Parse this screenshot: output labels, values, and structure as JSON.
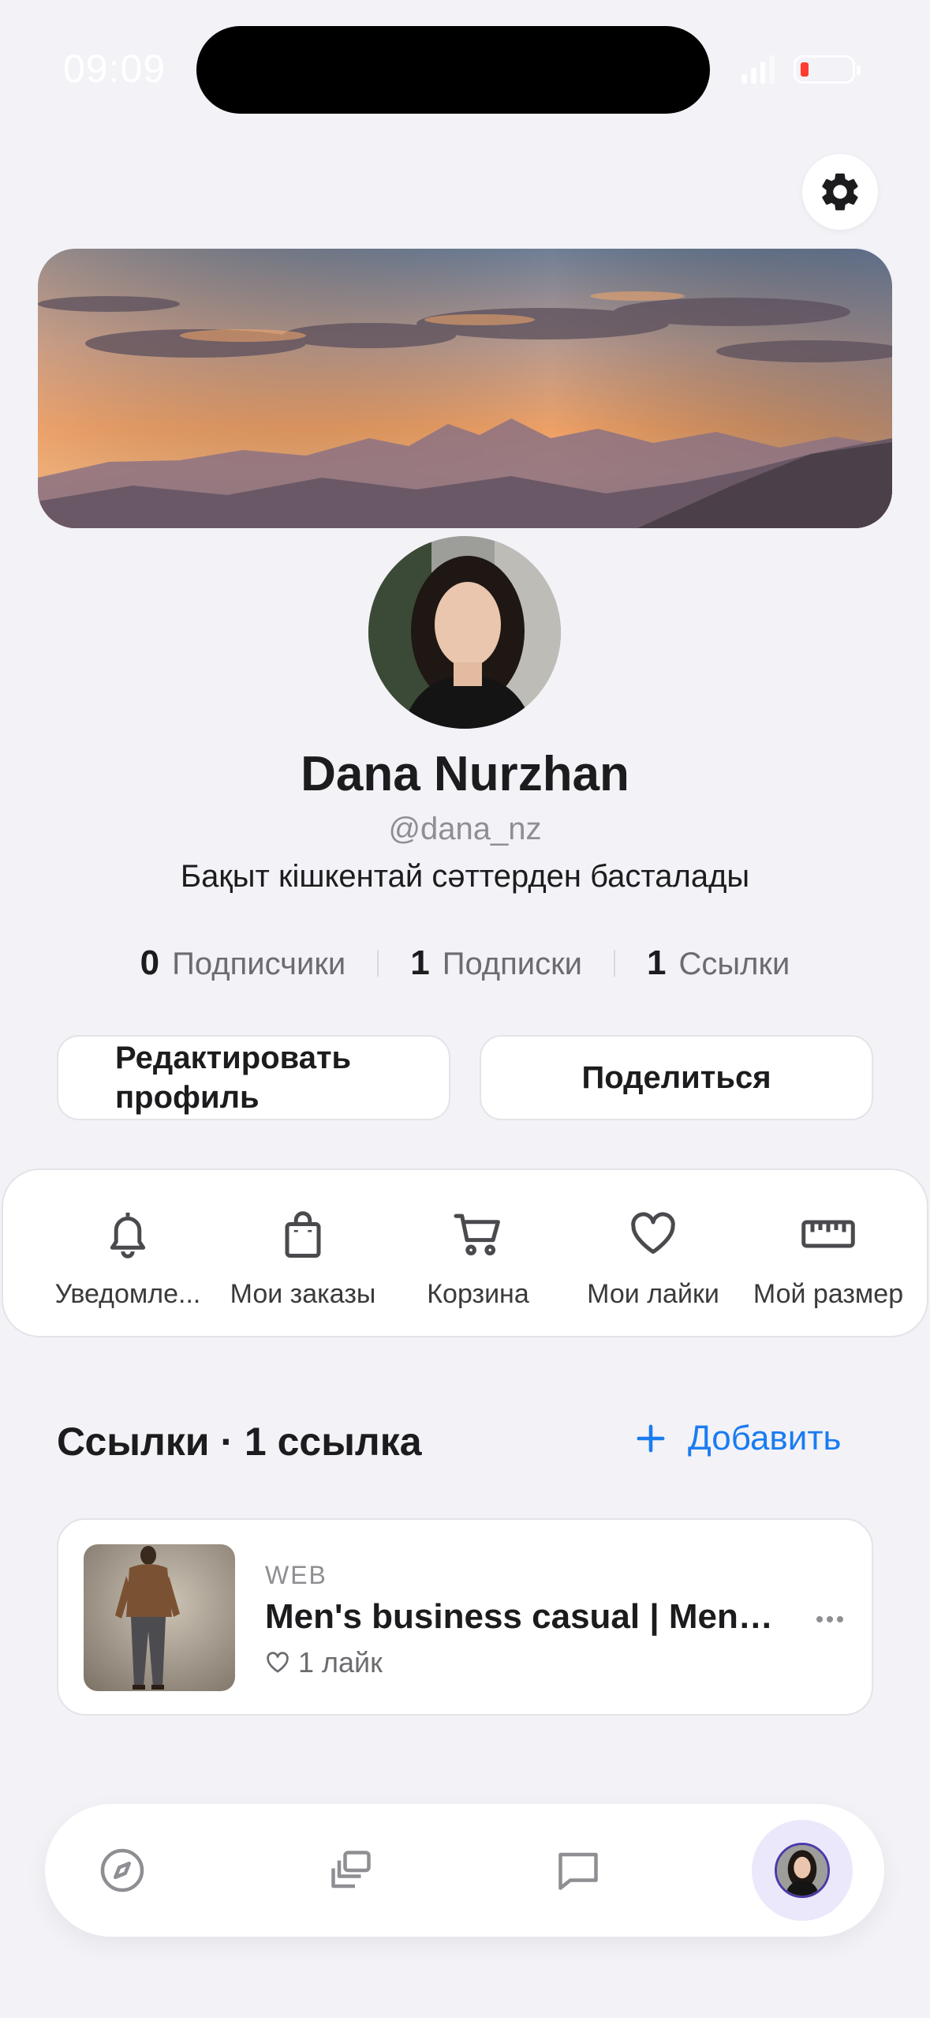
{
  "status_bar": {
    "time": "09:09"
  },
  "profile": {
    "name": "Dana Nurzhan",
    "handle": "@dana_nz",
    "bio": "Бақыт кішкентай сәттерден басталады"
  },
  "stats": [
    {
      "value": "0",
      "label": "Подписчики"
    },
    {
      "value": "1",
      "label": "Подписки"
    },
    {
      "value": "1",
      "label": "Ссылки"
    }
  ],
  "actions": {
    "edit_line1": "Редактировать",
    "edit_line2": "профиль",
    "share": "Поделиться"
  },
  "quick_menu": [
    {
      "label": "Уведомле...",
      "icon": "bell-icon"
    },
    {
      "label": "Мои заказы",
      "icon": "shopping-bag-icon"
    },
    {
      "label": "Корзина",
      "icon": "cart-icon"
    },
    {
      "label": "Мои лайки",
      "icon": "heart-icon"
    },
    {
      "label": "Мой размер",
      "icon": "ruler-icon"
    }
  ],
  "links_section": {
    "title": "Ссылки · 1 ссылка",
    "add_label": "Добавить"
  },
  "link_card": {
    "type": "WEB",
    "title": "Men's business casual | Mens...",
    "likes": "1 лайк"
  },
  "tab_bar": [
    {
      "icon": "compass-icon"
    },
    {
      "icon": "stack-icon"
    },
    {
      "icon": "chat-icon"
    },
    {
      "icon": "profile-avatar-icon"
    }
  ],
  "colors": {
    "accent": "#1a7cf0",
    "background": "#f2f2f7",
    "battery_low": "#ff3b30",
    "profile_tab_bg": "#ece8fb"
  }
}
